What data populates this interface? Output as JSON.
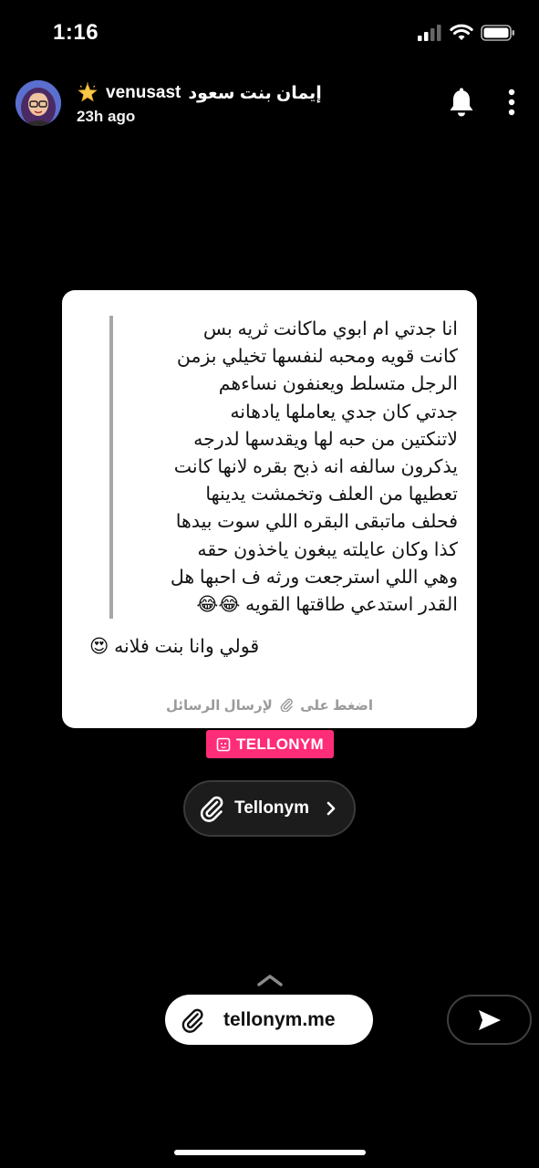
{
  "status_bar": {
    "time": "1:16"
  },
  "story": {
    "username": "venusast",
    "display_name": "إيمان بنت سعود",
    "posted_ago": "23h ago"
  },
  "message_card": {
    "quote_lines": [
      "انا جدتي ام ابوي ماكانت ثريه بس",
      "كانت قويه ومحبه لنفسها تخيلي بزمن",
      "الرجل متسلط ويعنفون نساءهم",
      "جدتي كان جدي يعاملها يادهانه",
      "لاتنكتين من حبه لها ويقدسها لدرجه",
      "يذكرون سالفه انه ذبح بقره لانها كانت",
      "تعطيها من العلف وتخمشت يدينها",
      "فحلف ماتبقى البقره اللي سوت بيدها",
      "كذا وكان عايلته يبغون ياخذون حقه",
      "وهي اللي استرجعت ورثه ف احبها هل",
      "القدر استدعي طاقتها القويه 😂😂"
    ],
    "reply": "قولي وانا بنت فلانه 😍",
    "footer_before": "اضغط على",
    "footer_after": "لإرسال الرسائل"
  },
  "brand_badge": {
    "label": "TELLONYM"
  },
  "link_sticker": {
    "label": "Tellonym"
  },
  "bottom_link": {
    "label": "tellonym.me"
  },
  "colors": {
    "background": "#000000",
    "card": "#ffffff",
    "brand_pink": "#ff2d78"
  },
  "icons": [
    "signal-icon",
    "wifi-icon",
    "battery-icon",
    "star-icon",
    "bell-icon",
    "more-icon",
    "paperclip-icon",
    "chevron-right-icon",
    "chevron-up-icon",
    "send-icon",
    "tellonym-logo-icon"
  ]
}
